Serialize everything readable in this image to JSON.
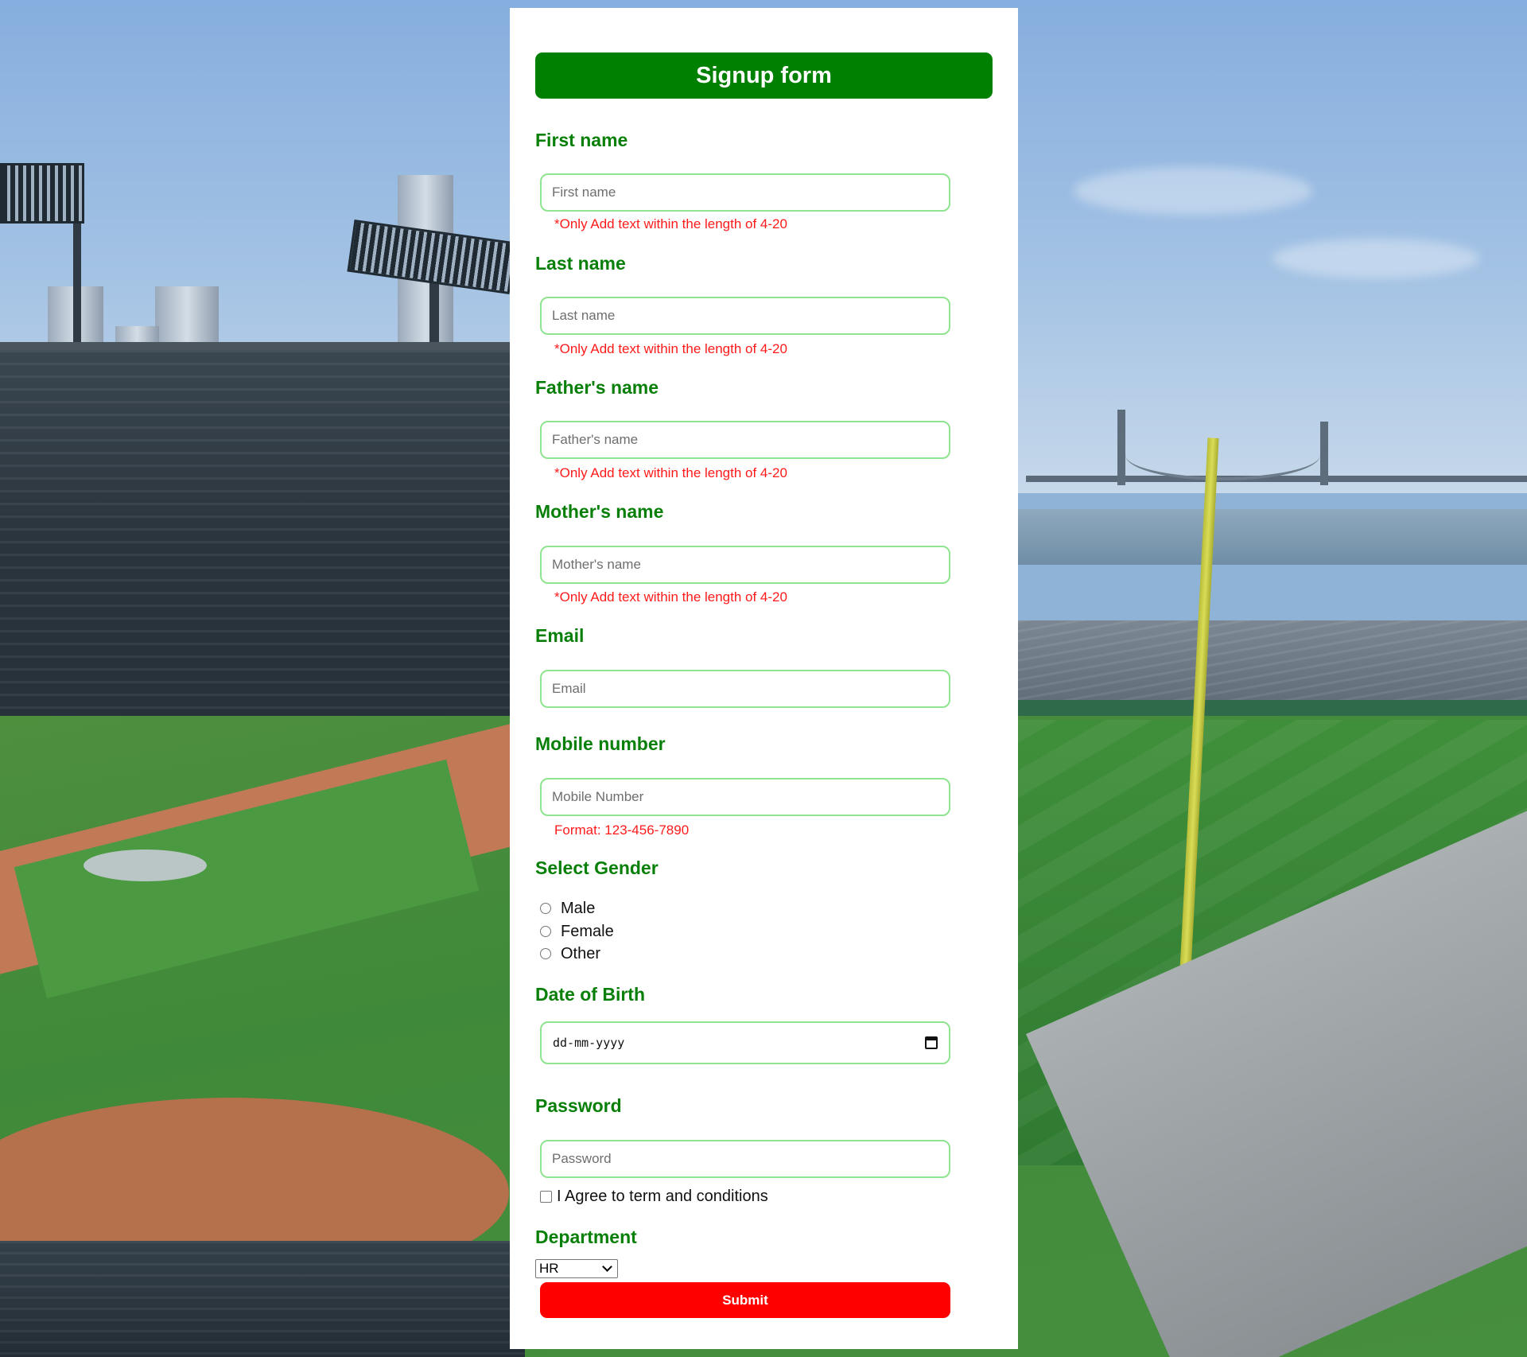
{
  "form": {
    "title": "Signup form",
    "first_name": {
      "label": "First name",
      "placeholder": "First name",
      "hint": "*Only Add text within the length of 4-20"
    },
    "last_name": {
      "label": "Last name",
      "placeholder": "Last name",
      "hint": "*Only Add text within the length of 4-20"
    },
    "fathers_name": {
      "label": "Father's name",
      "placeholder": "Father's name",
      "hint": "*Only Add text within the length of 4-20"
    },
    "mothers_name": {
      "label": "Mother's name",
      "placeholder": "Mother's name",
      "hint": "*Only Add text within the length of 4-20"
    },
    "email": {
      "label": "Email",
      "placeholder": "Email"
    },
    "mobile": {
      "label": "Mobile number",
      "placeholder": "Mobile Number",
      "hint": "Format: 123-456-7890"
    },
    "gender": {
      "label": "Select Gender",
      "options": [
        "Male",
        "Female",
        "Other"
      ]
    },
    "dob": {
      "label": "Date of Birth",
      "value": "dd-mm-yyyy"
    },
    "password": {
      "label": "Password",
      "placeholder": "Password"
    },
    "terms": {
      "label": "I Agree to term and conditions"
    },
    "department": {
      "label": "Department",
      "selected": "HR"
    },
    "submit_label": "Submit"
  },
  "colors": {
    "title_bg": "#008000",
    "label": "#087f08",
    "input_border": "#8fe48f",
    "hint": "#ff1a1a",
    "submit_bg": "#ff0000"
  },
  "background": {
    "icon": "baseball-stadium-photo"
  }
}
